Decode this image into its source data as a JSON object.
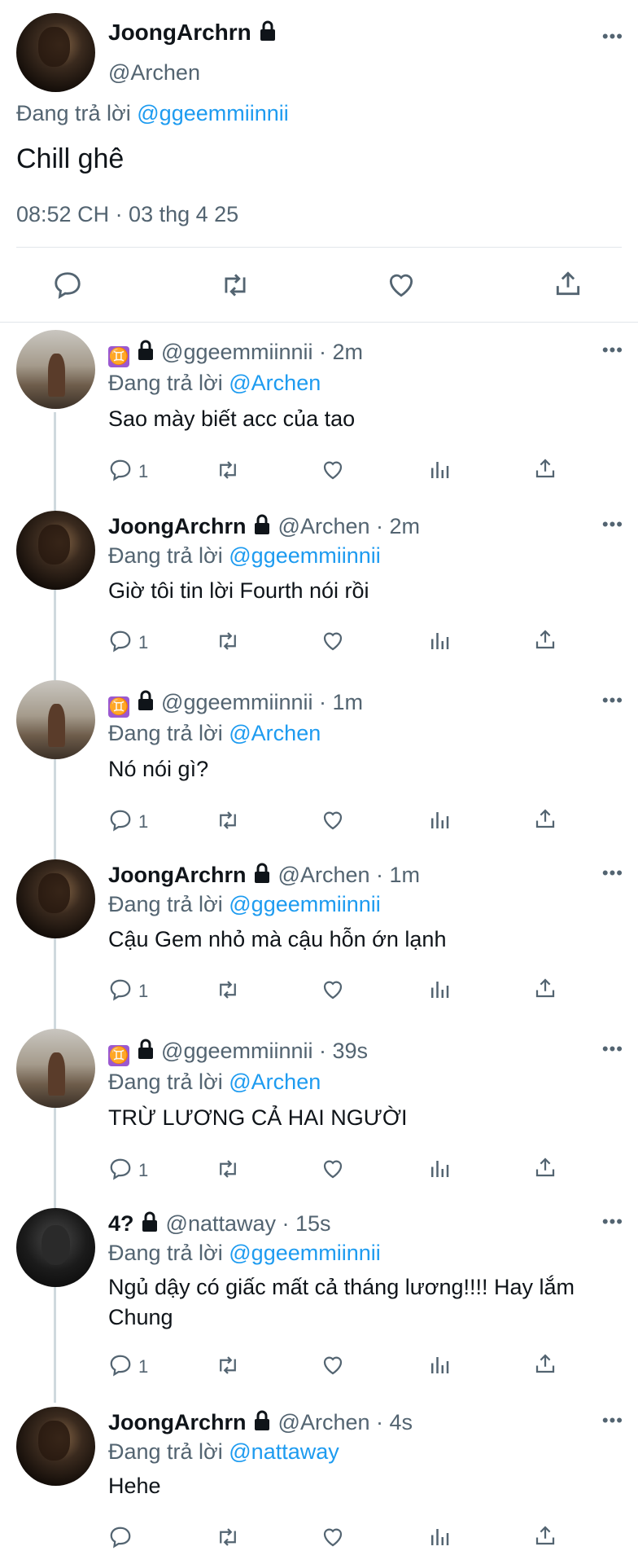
{
  "main_tweet": {
    "name": "JoongArchrn",
    "handle": "@Archen",
    "reply_prefix": "Đang trả lời ",
    "reply_to": "@ggeemmiinnii",
    "text": "Chill ghê",
    "timestamp": "08:52 CH · 03 thg 4 25",
    "more": "•••"
  },
  "replies": [
    {
      "emoji": "♊",
      "name": "",
      "handle": "@ggeemmiinnii",
      "time": " · 2m",
      "reply_prefix": "Đang trả lời ",
      "reply_to": "@Archen",
      "text": "Sao mày biết acc của tao",
      "reply_count": "1"
    },
    {
      "emoji": "",
      "name": "JoongArchrn",
      "handle": "@Archen",
      "time": " · 2m",
      "reply_prefix": "Đang trả lời ",
      "reply_to": "@ggeemmiinnii",
      "text": "Giờ tôi tin lời Fourth nói rồi",
      "reply_count": "1"
    },
    {
      "emoji": "♊",
      "name": "",
      "handle": "@ggeemmiinnii",
      "time": " · 1m",
      "reply_prefix": "Đang trả lời ",
      "reply_to": "@Archen",
      "text": "Nó nói gì?",
      "reply_count": "1"
    },
    {
      "emoji": "",
      "name": "JoongArchrn",
      "handle": "@Archen",
      "time": " · 1m",
      "reply_prefix": "Đang trả lời ",
      "reply_to": "@ggeemmiinnii",
      "text": "Cậu Gem nhỏ mà cậu hỗn ớn lạnh",
      "reply_count": "1"
    },
    {
      "emoji": "♊",
      "name": "",
      "handle": "@ggeemmiinnii",
      "time": " · 39s",
      "reply_prefix": "Đang trả lời ",
      "reply_to": "@Archen",
      "text": "TRỪ LƯƠNG CẢ HAI NGƯỜI",
      "reply_count": "1"
    },
    {
      "emoji": "",
      "name": "4?",
      "handle": "@nattaway",
      "time": " · 15s",
      "reply_prefix": "Đang trả lời ",
      "reply_to": "@ggeemmiinnii",
      "text": "Ngủ dậy có giấc mất cả tháng lương!!!! Hay lắm Chung",
      "reply_count": "1"
    },
    {
      "emoji": "",
      "name": "JoongArchrn",
      "handle": "@Archen",
      "time": " · 4s",
      "reply_prefix": "Đang trả lời ",
      "reply_to": "@nattaway",
      "text": "Hehe",
      "reply_count": ""
    }
  ],
  "icons": [
    "reply-icon",
    "retweet-icon",
    "like-icon",
    "share-icon",
    "views-icon",
    "lock-icon",
    "more-icon"
  ]
}
